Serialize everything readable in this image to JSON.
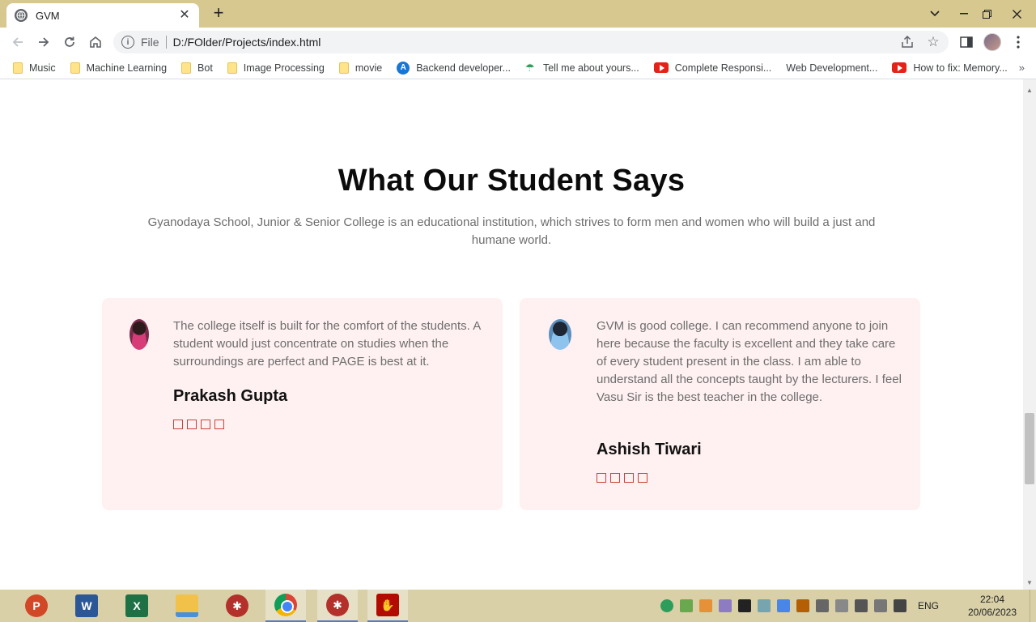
{
  "browser": {
    "tab_title": "GVM",
    "url_scheme": "File",
    "url": "D:/FOlder/Projects/index.html",
    "new_tab_label": "+",
    "close_tab_label": "✕"
  },
  "bookmarks": [
    {
      "label": "Music",
      "icon": "folder-icon"
    },
    {
      "label": "Machine Learning",
      "icon": "folder-icon"
    },
    {
      "label": "Bot",
      "icon": "folder-icon"
    },
    {
      "label": "Image Processing",
      "icon": "folder-icon"
    },
    {
      "label": "movie",
      "icon": "folder-icon"
    },
    {
      "label": "Backend developer...",
      "icon": "angular-icon"
    },
    {
      "label": "Tell me about yours...",
      "icon": "umbrella-icon"
    },
    {
      "label": "Complete Responsi...",
      "icon": "youtube-icon"
    },
    {
      "label": "Web Development...",
      "icon": "blank"
    },
    {
      "label": "How to fix: Memory...",
      "icon": "youtube-icon"
    }
  ],
  "section": {
    "title": "What Our Student Says",
    "subtitle": "Gyanodaya School, Junior & Senior College is an educational institution, which strives to form men and women who will build a just and humane world."
  },
  "testimonials": [
    {
      "quote": "The college itself is built for the comfort of the students. A student would just concentrate on studies when the surroundings are perfect and PAGE is best at it.",
      "name": "Prakash Gupta",
      "stars": 4
    },
    {
      "quote": "GVM is good college. I can recommend anyone to join here because the faculty is excellent and they take care of every student present in the class. I am able to understand all the concepts taught by the lecturers. I feel Vasu Sir is the best teacher in the college.",
      "name": "Ashish Tiwari",
      "stars": 4
    }
  ],
  "taskbar": {
    "language": "ENG",
    "time": "22:04",
    "date": "20/06/2023"
  },
  "colors": {
    "card_bg": "#fff1f1",
    "star_outline": "#c9413b",
    "tabstrip_bg": "#d6c88e",
    "taskbar_bg": "#d9d0a8"
  }
}
